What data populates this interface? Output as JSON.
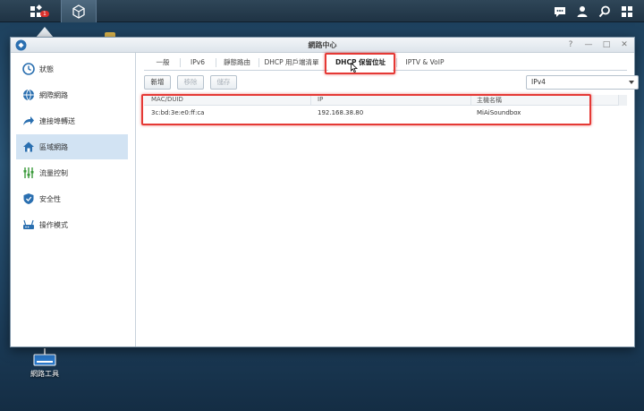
{
  "taskbar": {
    "notification_count": "1"
  },
  "desktop": {
    "network_tool_label": "網路工具"
  },
  "window": {
    "title": "網路中心",
    "controls": {
      "help": "?",
      "minimize": "—",
      "maximize": "□",
      "close": "✕"
    }
  },
  "sidebar": {
    "items": [
      {
        "label": "狀態",
        "icon": "clock-icon"
      },
      {
        "label": "網際網路",
        "icon": "globe-icon"
      },
      {
        "label": "連接埠轉送",
        "icon": "arrow-forward-icon"
      },
      {
        "label": "區域網路",
        "icon": "home-network-icon"
      },
      {
        "label": "流量控制",
        "icon": "sliders-icon"
      },
      {
        "label": "安全性",
        "icon": "shield-icon"
      },
      {
        "label": "操作模式",
        "icon": "router-icon"
      }
    ],
    "active_index": 3
  },
  "tabs": [
    {
      "label": "一般"
    },
    {
      "label": "IPv6"
    },
    {
      "label": "靜態路由"
    },
    {
      "label": "DHCP 用戶端清單"
    },
    {
      "label": "DHCP 保留位址"
    },
    {
      "label": "IPTV & VoIP"
    }
  ],
  "active_tab_index": 4,
  "toolbar": {
    "add_label": "新增",
    "remove_label": "移除",
    "save_label": "儲存",
    "ip_version": "IPv4"
  },
  "table": {
    "columns": [
      "MAC/DUID",
      "IP",
      "主機名稱"
    ],
    "rows": [
      [
        "3c:bd:3e:e0:ff:ca",
        "192.168.38.80",
        "MiAiSoundbox"
      ]
    ]
  },
  "colors": {
    "highlight": "#e53935",
    "active_side": "#d2e3f3",
    "accent": "#2a6fb0"
  }
}
